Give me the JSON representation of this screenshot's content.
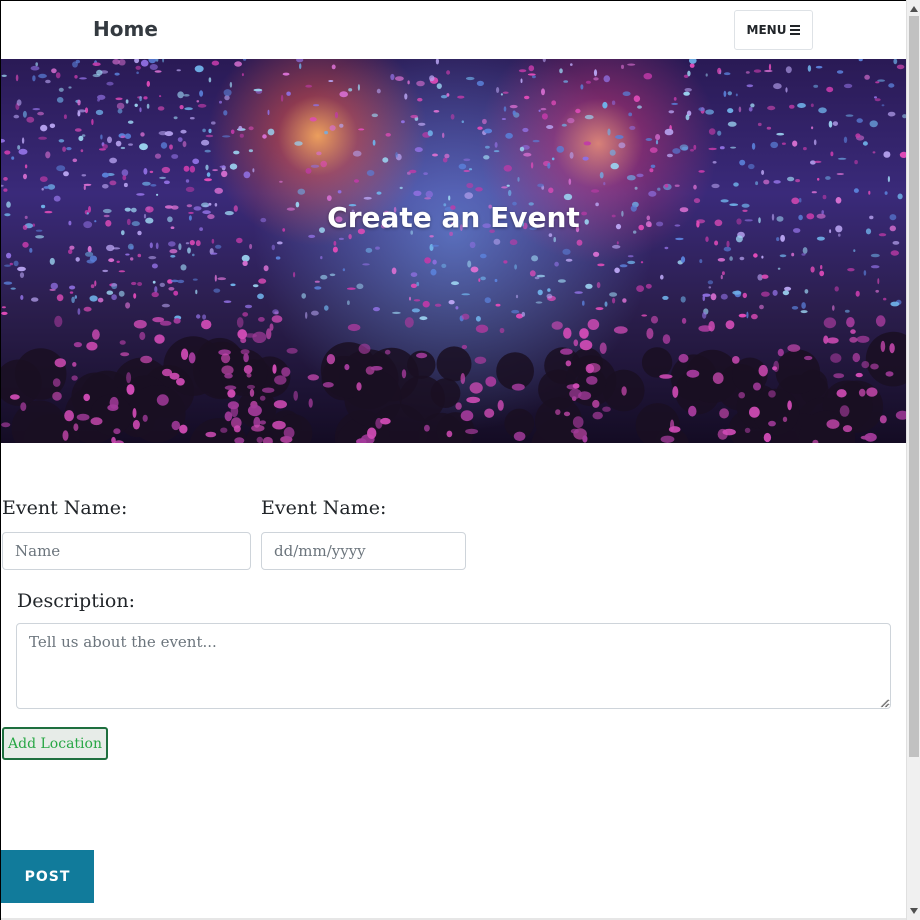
{
  "navbar": {
    "brand": "Home",
    "menu_label": "MENU",
    "menu_icon": "hamburger-icon"
  },
  "hero": {
    "title": "Create an Event",
    "image": "concert-confetti-crowd"
  },
  "form": {
    "event_name_label": "Event Name:",
    "event_name_placeholder": "Name",
    "date_label": "Event Name:",
    "date_placeholder": "dd/mm/yyyy",
    "description_label": "Description:",
    "description_placeholder": "Tell us about the event...",
    "add_location_label": "Add Location",
    "post_label": "POST"
  },
  "colors": {
    "post_button": "#117b9b",
    "add_location_text": "#28a745",
    "add_location_border": "#1e6f3e"
  }
}
